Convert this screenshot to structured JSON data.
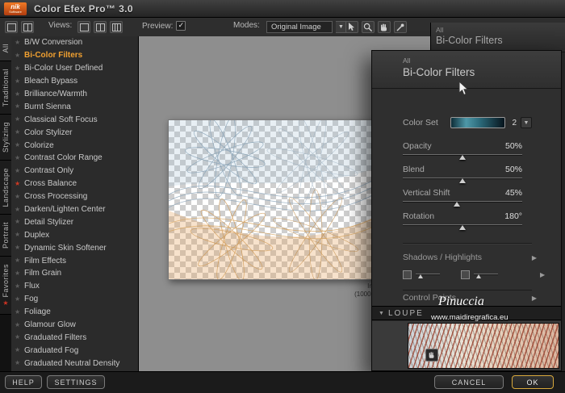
{
  "colors": {
    "accent_orange": "#f0a030",
    "red_star": "#cc3a24",
    "ok_button_border": "#d8a93c",
    "color_set_teal": "#4e98a8",
    "canvas_gray": "#8e8e8e",
    "panel_dark": "#2f2f2f"
  },
  "titlebar": {
    "logo_text": "nik",
    "logo_sub": "Software",
    "title": "Color Efex Pro™ 3.0"
  },
  "toolbar": {
    "views_label": "Views:",
    "preview_label": "Preview:",
    "preview_checked": true,
    "modes_label": "Modes:",
    "mode_value": "Original Image"
  },
  "left_tabs": [
    {
      "label": "All",
      "active": true
    },
    {
      "label": "Traditional"
    },
    {
      "label": "Stylizing"
    },
    {
      "label": "Landscape"
    },
    {
      "label": "Portrait"
    },
    {
      "label": "Favorites",
      "star": "red"
    }
  ],
  "filters": [
    {
      "label": "B/W Conversion",
      "star": "dim"
    },
    {
      "label": "Bi-Color Filters",
      "star": "dim",
      "selected": true
    },
    {
      "label": "Bi-Color User Defined",
      "star": "dim"
    },
    {
      "label": "Bleach Bypass",
      "star": "dim"
    },
    {
      "label": "Brilliance/Warmth",
      "star": "dim"
    },
    {
      "label": "Burnt Sienna",
      "star": "dim"
    },
    {
      "label": "Classical Soft Focus",
      "star": "dim"
    },
    {
      "label": "Color Stylizer",
      "star": "dim"
    },
    {
      "label": "Colorize",
      "star": "dim"
    },
    {
      "label": "Contrast Color Range",
      "star": "dim"
    },
    {
      "label": "Contrast Only",
      "star": "dim"
    },
    {
      "label": "Cross Balance",
      "star": "red"
    },
    {
      "label": "Cross Processing",
      "star": "dim"
    },
    {
      "label": "Darken/Lighten Center",
      "star": "dim"
    },
    {
      "label": "Detail Stylizer",
      "star": "dim"
    },
    {
      "label": "Duplex",
      "star": "dim"
    },
    {
      "label": "Dynamic Skin Softener",
      "star": "dim"
    },
    {
      "label": "Film Effects",
      "star": "dim"
    },
    {
      "label": "Film Grain",
      "star": "dim"
    },
    {
      "label": "Flux",
      "star": "dim"
    },
    {
      "label": "Fog",
      "star": "dim"
    },
    {
      "label": "Foliage",
      "star": "dim"
    },
    {
      "label": "Glamour Glow",
      "star": "dim"
    },
    {
      "label": "Graduated Filters",
      "star": "dim"
    },
    {
      "label": "Graduated Fog",
      "star": "dim"
    },
    {
      "label": "Graduated Neutral Density",
      "star": "dim"
    }
  ],
  "preview_caption": {
    "line1": "Im",
    "line2": "(1000 ."
  },
  "right_panel": {
    "bg_header_small": "All",
    "bg_header_title": "Bi-Color Filters",
    "header_small": "All",
    "title": "Bi-Color Filters",
    "color_set_label": "Color Set",
    "color_set_value": "2",
    "sliders": [
      {
        "label": "Opacity",
        "value": "50%",
        "pos": "50%"
      },
      {
        "label": "Blend",
        "value": "50%",
        "pos": "50%"
      },
      {
        "label": "Vertical Shift",
        "value": "45%",
        "pos": "45%"
      },
      {
        "label": "Rotation",
        "value": "180°",
        "pos": "50%"
      }
    ],
    "shadows_highlights_label": "Shadows / Highlights",
    "control_points_label": "Control Points",
    "loupe_label": "LOUPE"
  },
  "watermark": {
    "line1": "Pinuccia",
    "line2": "www.maidiregrafica.eu"
  },
  "footer": {
    "help": "HELP",
    "settings": "SETTINGS",
    "cancel": "CANCEL",
    "ok": "OK"
  }
}
